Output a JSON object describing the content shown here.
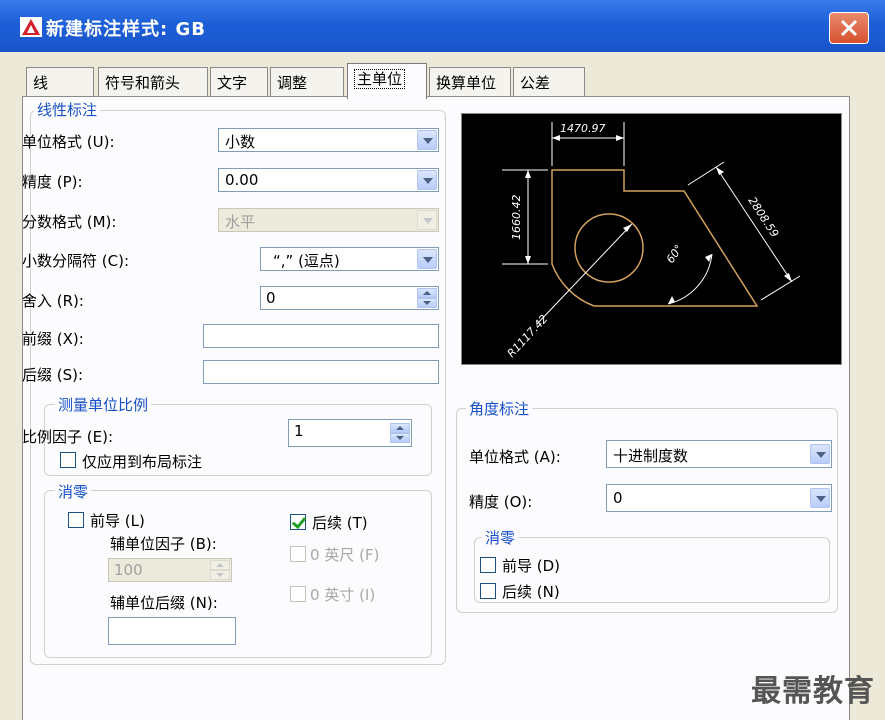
{
  "window": {
    "title": "新建标注样式: GB"
  },
  "tabs": [
    {
      "label": "线"
    },
    {
      "label": "符号和箭头"
    },
    {
      "label": "文字"
    },
    {
      "label": "调整"
    },
    {
      "label": "主单位"
    },
    {
      "label": "换算单位"
    },
    {
      "label": "公差"
    }
  ],
  "linear": {
    "title": "线性标注",
    "unit_format": {
      "label": "单位格式 (U):",
      "value": "小数"
    },
    "precision": {
      "label": "精度 (P):",
      "value": "0.00"
    },
    "fraction_format": {
      "label": "分数格式 (M):",
      "value": "水平"
    },
    "decimal_separator": {
      "label": "小数分隔符 (C):",
      "value": "“,” (逗点)"
    },
    "round_off": {
      "label": "舍入 (R):",
      "value": "0"
    },
    "prefix": {
      "label": "前缀 (X):",
      "value": ""
    },
    "suffix": {
      "label": "后缀 (S):",
      "value": ""
    }
  },
  "measurement_scale": {
    "title": "测量单位比例",
    "scale_factor": {
      "label": "比例因子 (E):",
      "value": "1"
    },
    "apply_layout": {
      "label": "仅应用到布局标注",
      "checked": false
    }
  },
  "zero_suppression": {
    "title": "消零",
    "leading": {
      "label": "前导 (L)",
      "checked": false
    },
    "trailing": {
      "label": "后续 (T)",
      "checked": true
    },
    "sub_unit_factor": {
      "label": "辅单位因子 (B):",
      "value": "100"
    },
    "feet": {
      "label": "0 英尺 (F)",
      "checked": false
    },
    "inches": {
      "label": "0 英寸 (I)",
      "checked": false
    },
    "sub_unit_suffix": {
      "label": "辅单位后缀 (N):",
      "value": ""
    }
  },
  "angular": {
    "title": "角度标注",
    "unit_format": {
      "label": "单位格式 (A):",
      "value": "十进制度数"
    },
    "precision": {
      "label": "精度 (O):",
      "value": "0"
    },
    "zero_title": "消零",
    "leading": {
      "label": "前导 (D)",
      "checked": false
    },
    "trailing": {
      "label": "后续 (N)",
      "checked": false
    }
  },
  "preview": {
    "dim_top": "1470.97",
    "dim_left": "1660.42",
    "dim_right": "2808.59",
    "dim_angle": "60°",
    "dim_radius": "R1117.42",
    "colors": {
      "geometry": "#d4a060",
      "dimension": "#ffffff",
      "background": "#000000"
    }
  },
  "watermark": "最需教育"
}
